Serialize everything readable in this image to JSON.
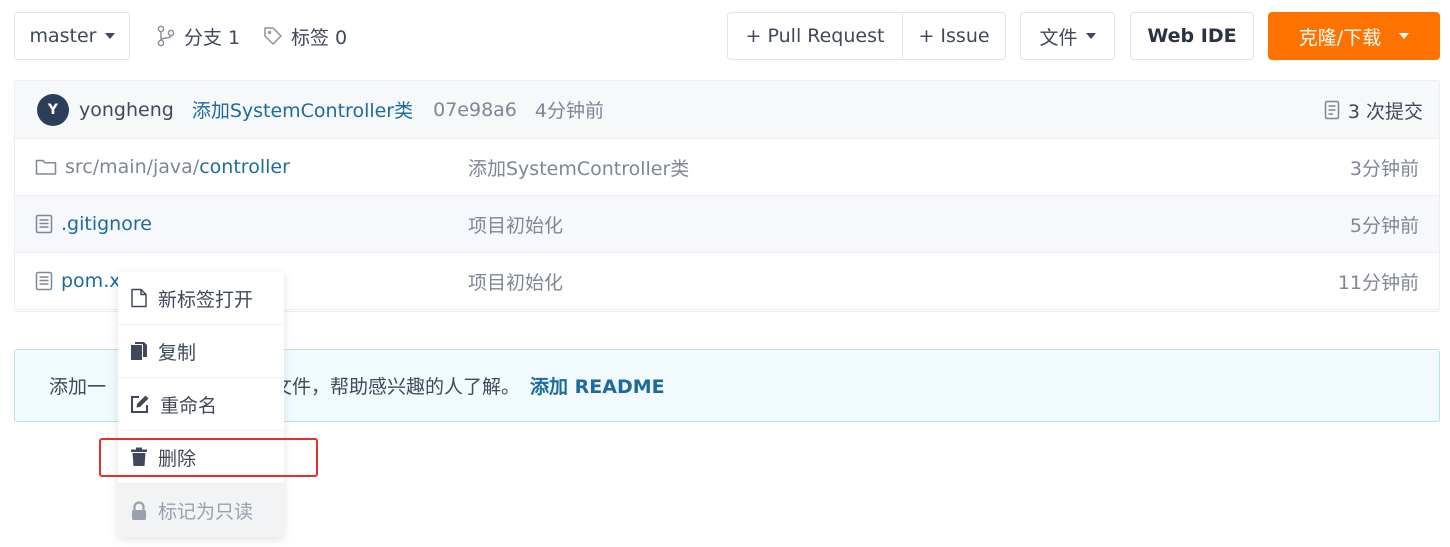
{
  "toolbar": {
    "branch_label": "master",
    "branches_label": "分支 1",
    "tags_label": "标签 0",
    "pull_request_label": "+ Pull Request",
    "issue_label": "+ Issue",
    "file_label": "文件",
    "web_ide_label": "Web IDE",
    "clone_label": "克隆/下载",
    "clone_color": "#fe7300"
  },
  "commit": {
    "avatar_letter": "Y",
    "user": "yongheng",
    "message": "添加SystemController类",
    "sha": "07e98a6",
    "time": "4分钟前",
    "count_label": "3 次提交"
  },
  "files": [
    {
      "prefix": "src/main/java/",
      "name": "controller",
      "icon": "folder-icon",
      "message": "添加SystemController类",
      "time": "3分钟前"
    },
    {
      "prefix": "",
      "name": ".gitignore",
      "icon": "file-text-icon",
      "message": "项目初始化",
      "time": "5分钟前"
    },
    {
      "prefix": "",
      "name": "pom.x",
      "icon": "file-text-icon",
      "message": "项目初始化",
      "time": "11分钟前"
    }
  ],
  "notice": {
    "text_start": "添加一",
    "text_end": "文件，帮助感兴趣的人了解。",
    "link_label": "添加 README"
  },
  "context_menu": {
    "items": [
      {
        "label": "新标签打开",
        "icon": "new-tab-icon"
      },
      {
        "label": "复制",
        "icon": "copy-icon"
      },
      {
        "label": "重命名",
        "icon": "edit-icon"
      },
      {
        "label": "删除",
        "icon": "trash-icon"
      },
      {
        "label": "标记为只读",
        "icon": "lock-icon",
        "disabled": true
      }
    ],
    "highlight_color": "#e0322b"
  }
}
